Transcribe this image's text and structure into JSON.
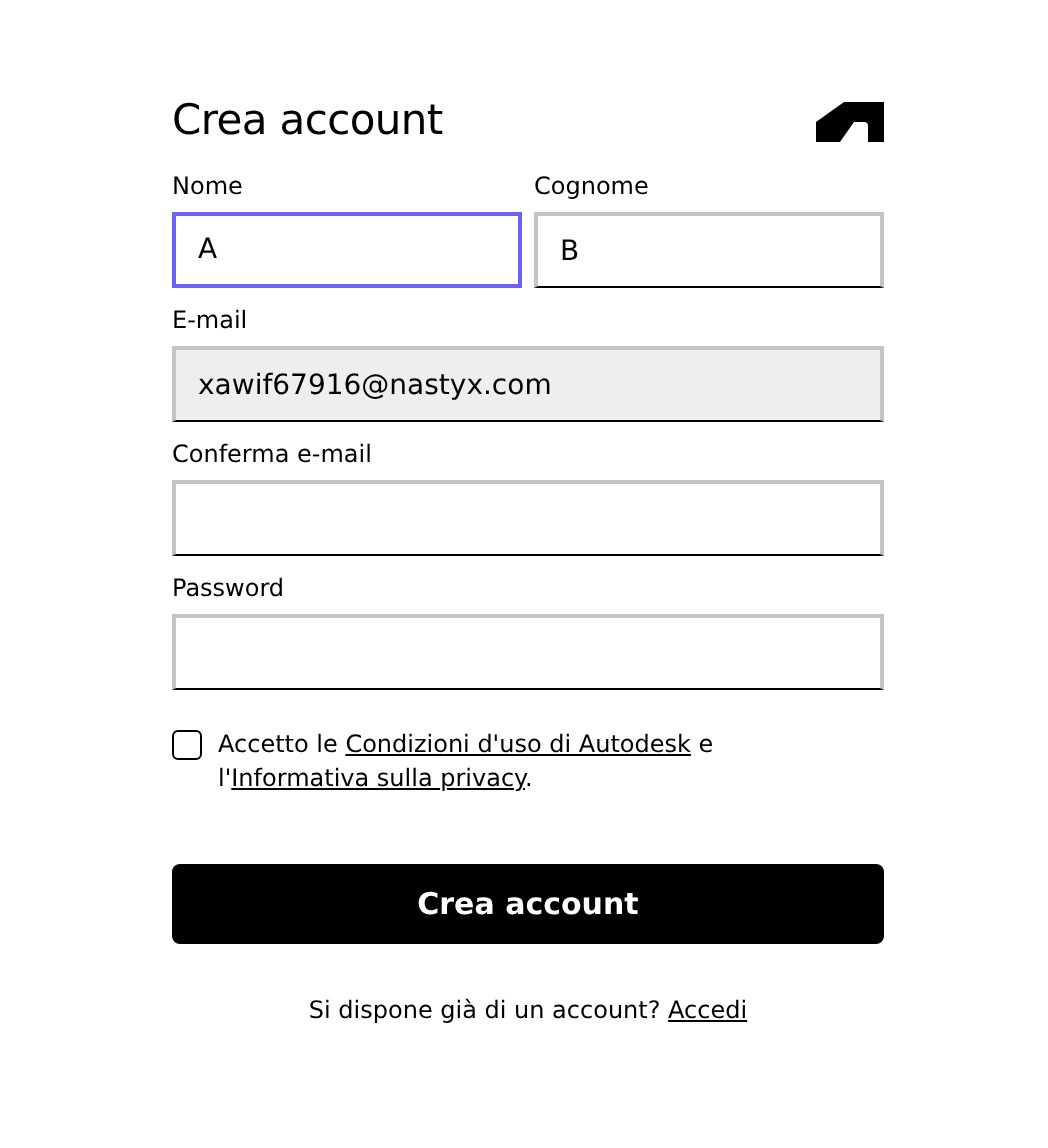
{
  "title": "Crea account",
  "name_row": [
    {
      "label": "Nome",
      "value": "A",
      "focused": true,
      "disabled": false
    },
    {
      "label": "Cognome",
      "value": "B",
      "focused": false,
      "disabled": false
    }
  ],
  "fields": [
    {
      "label": "E-mail",
      "value": "xawif67916@nastyx.com",
      "focused": false,
      "disabled": true
    },
    {
      "label": "Conferma e-mail",
      "focused": false,
      "disabled": false
    },
    {
      "label": "Password",
      "focused": false,
      "disabled": false
    }
  ],
  "agreement": {
    "checked": false,
    "parts": [
      {
        "kind": "text",
        "text": "Accetto le "
      },
      {
        "kind": "link",
        "text": "Condizioni d'uso di Autodesk"
      },
      {
        "kind": "text",
        "text": " e l'"
      },
      {
        "kind": "link",
        "text": "Informativa sulla privacy"
      },
      {
        "kind": "text",
        "text": "."
      }
    ]
  },
  "submit_button": "Crea account",
  "footer": {
    "parts": [
      {
        "kind": "text",
        "text": "Si dispone già di un account? "
      },
      {
        "kind": "link",
        "text": "Accedi"
      }
    ]
  }
}
